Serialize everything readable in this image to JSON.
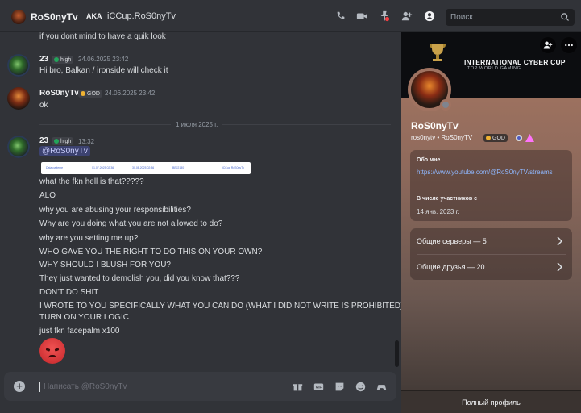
{
  "header": {
    "username": "RoS0nyTv",
    "aka_label": "AKA",
    "nickname": "iCCup.RoS0nyTv",
    "search_placeholder": "Поиск",
    "icons": [
      "voice-call-icon",
      "video-call-icon",
      "pin-icon",
      "add-friend-icon",
      "profile-toggle-icon",
      "search-icon"
    ]
  },
  "messages": {
    "m0": {
      "text": "if you dont mind to have a quik look"
    },
    "m1": {
      "author": "23",
      "tag": "high",
      "timestamp": "24.06.2025 23:42",
      "text": "Hi bro, Balkan / ironside will check it"
    },
    "m2": {
      "author": "RoS0nyTv",
      "tag": "GOD",
      "timestamp": "24.06.2025 23:42",
      "text": "ok"
    },
    "date_divider": "1 июля 2025 г.",
    "m3": {
      "author": "23",
      "tag": "high",
      "timestamp": "13:32",
      "mention": "@RoS0nyTv",
      "embed": [
        "Data-pažeme",
        "01.07.2025 02:36",
        "30.08.2025 02:36",
        "BBJ2180",
        "iCCup RoS0nyTv"
      ],
      "lines": [
        "what the fkn hell is that?????",
        "ALO",
        "why you are abusing your responsibilities?",
        "Why are you doing what you are not allowed to do?",
        "why are you setting me up?",
        "WHO GAVE YOU THE RIGHT TO DO THIS ON YOUR OWN?",
        "WHY SHOULD I BLUSH FOR YOU?",
        "They just wanted to demolish you, did you know that???",
        "DON'T DO SHIT",
        "I WROTE TO YOU SPECIFICALLY WHAT YOU CAN DO (WHAT I DID NOT WRITE IS PROHIBITED)",
        "TURN ON YOUR LOGIC",
        "just fkn facepalm x100"
      ],
      "emoji": "angry-face"
    }
  },
  "composer": {
    "placeholder": "Написать @RoS0nyTv",
    "icons": [
      "gift-icon",
      "gif-icon",
      "sticker-icon",
      "emoji-icon",
      "apps-icon"
    ]
  },
  "profile": {
    "banner_title": "INTERNATIONAL CYBER CUP",
    "banner_subtitle": "TOP WORLD GAMING",
    "display_name": "RoS0nyTv",
    "username": "ros0nytv",
    "nickname": "RoS0nyTV",
    "badge": "GOD",
    "about_label": "Обо мне",
    "about_link": "https://www.youtube.com/@RoS0nyTV/streams",
    "member_since_label": "В числе участников с",
    "member_since": "14 янв. 2023 г.",
    "mutual_servers": "Общие серверы — 5",
    "mutual_friends": "Общие друзья — 20",
    "full_profile": "Полный профиль"
  },
  "colors": {
    "accent": "#5865f2",
    "link": "#8fb8ff",
    "badge_high": "#23a55a",
    "badge_god": "#f0b232"
  }
}
